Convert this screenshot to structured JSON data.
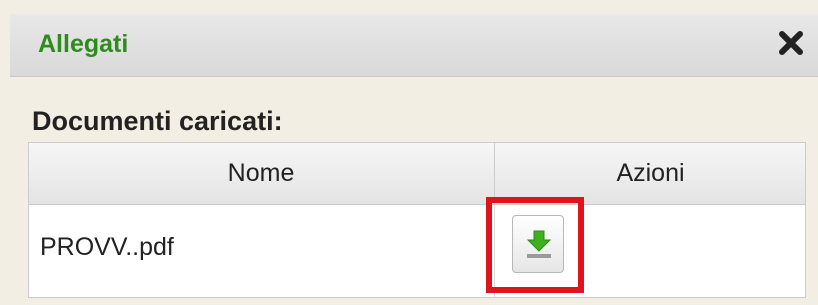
{
  "dialog": {
    "title": "Allegati",
    "close_icon": "close-icon"
  },
  "section": {
    "title": "Documenti caricati:"
  },
  "table": {
    "columns": [
      "Nome",
      "Azioni"
    ],
    "rows": [
      {
        "name": "PROVV..pdf",
        "action_icon": "download-icon"
      }
    ]
  },
  "colors": {
    "title_green": "#2e8b1e",
    "highlight_red": "#e0141e",
    "download_green": "#3cb021"
  }
}
